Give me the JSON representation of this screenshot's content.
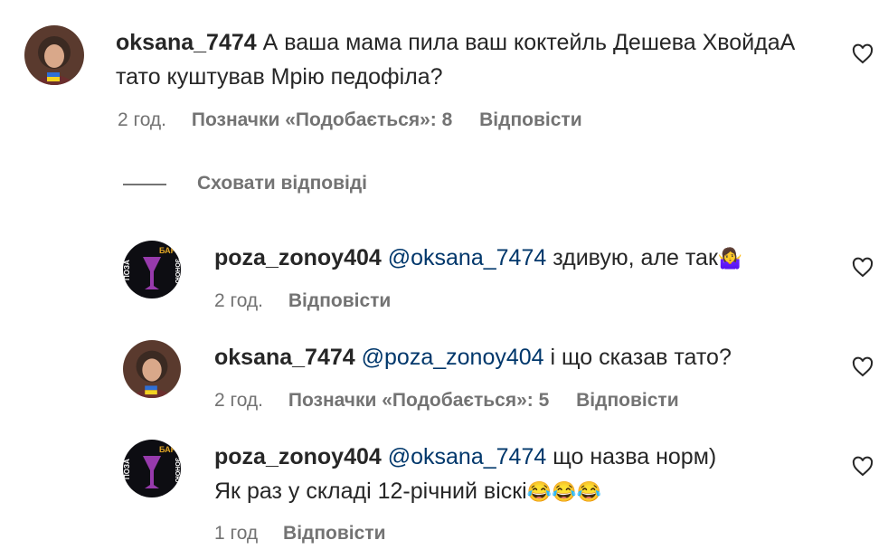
{
  "comments": [
    {
      "username": "oksana_7474",
      "mention": "",
      "text": "А ваша мама пила ваш коктейль Дешева ХвойдаА тато куштував Мрію педофіла?",
      "time": "2 год.",
      "likes": "Позначки «Подобається»: 8",
      "reply": "Відповісти",
      "avatar": "avatar-oksana"
    },
    {
      "username": "poza_zonoy404",
      "mention": "@oksana_7474",
      "text": "здивую, але так",
      "emoji": "🤷‍♀️",
      "time": "2 год.",
      "likes": "",
      "reply": "Відповісти",
      "avatar": "avatar-poza"
    },
    {
      "username": "oksana_7474",
      "mention": "@poza_zonoy404",
      "text": "і що сказав тато?",
      "time": "2 год.",
      "likes": "Позначки «Подобається»: 5",
      "reply": "Відповісти",
      "avatar": "avatar-oksana"
    },
    {
      "username": "poza_zonoy404",
      "mention": "@oksana_7474",
      "text": "що назва норм)",
      "line2": "Як раз у складі 12-річний віскі",
      "emoji": "😂😂😂",
      "time": "1 год",
      "likes": "",
      "reply": "Відповісти",
      "avatar": "avatar-poza"
    }
  ],
  "replies_toggle": {
    "label": "Сховати відповіді"
  },
  "avatar_logo_text": {
    "top": "БАР",
    "left": "ПОЗА",
    "right": "ЗОНОЮ"
  },
  "icons": {
    "like": "heart-icon"
  },
  "colors": {
    "mention": "#00376b",
    "meta": "#737373",
    "text": "#262626"
  }
}
